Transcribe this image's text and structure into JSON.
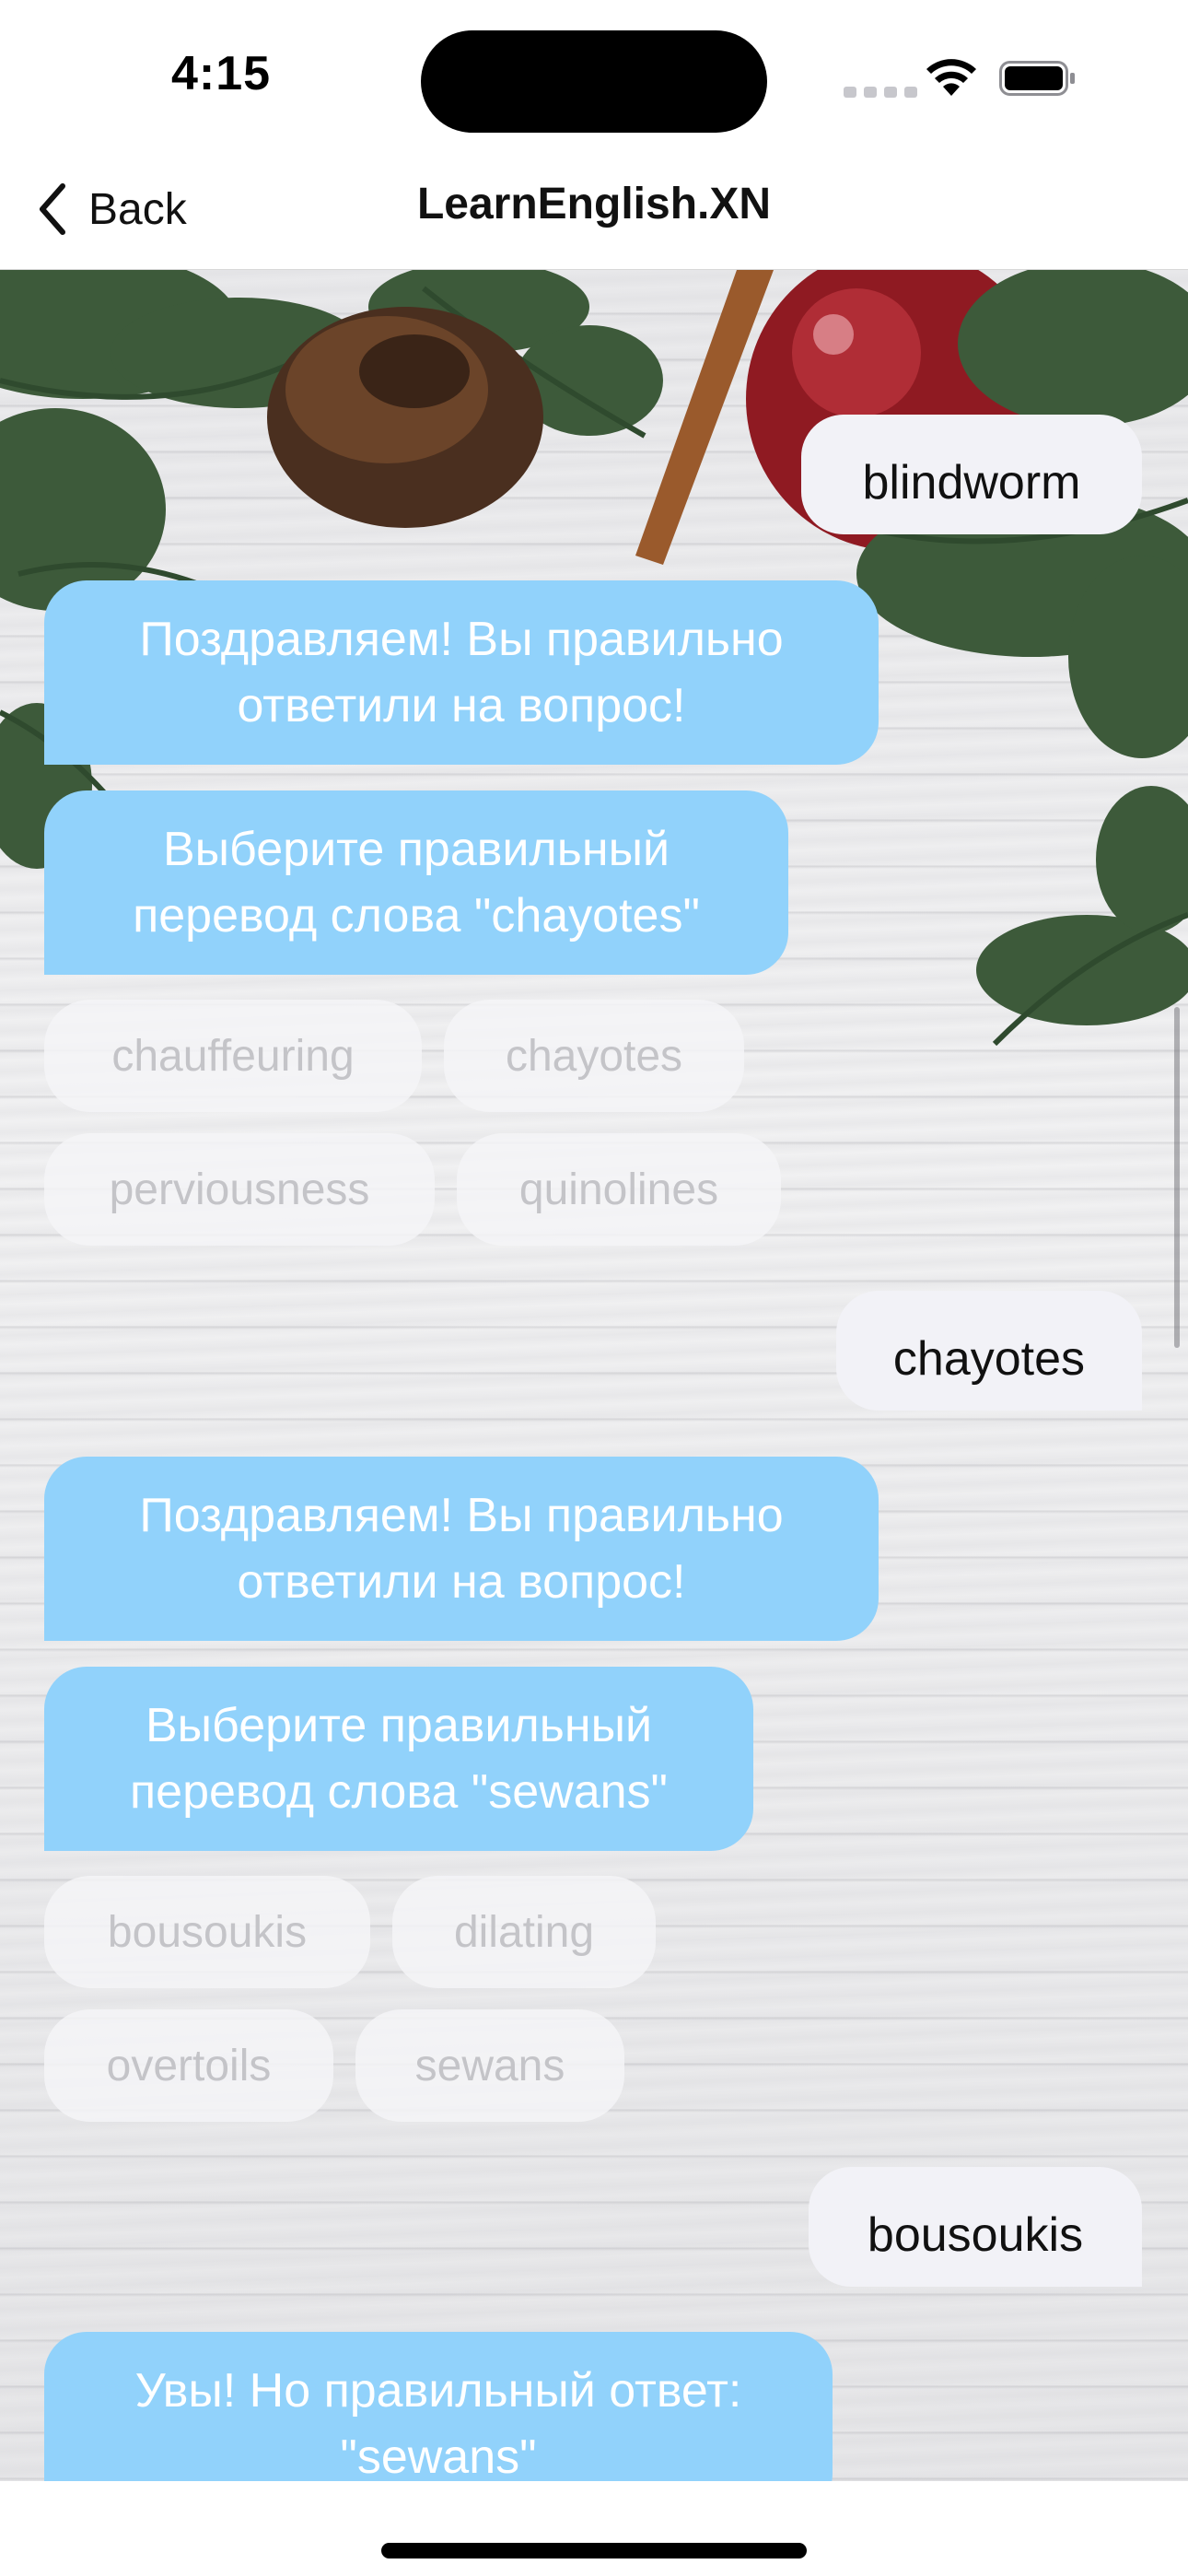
{
  "status_bar": {
    "time": "4:15"
  },
  "nav": {
    "back_label": "Back",
    "title": "LearnEnglish.XN"
  },
  "messages": {
    "user_1": "blindworm",
    "bot_1": "Поздравляем! Вы правильно ответили на вопрос!",
    "bot_2": "Выберите правильный перевод слова \"chayotes\"",
    "choices_1": [
      "chauffeuring",
      "chayotes",
      "perviousness",
      "quinolines"
    ],
    "user_2": "chayotes",
    "bot_3": "Поздравляем! Вы правильно ответили на вопрос!",
    "bot_4": "Выберите правильный перевод слова \"sewans\"",
    "choices_2": [
      "bousoukis",
      "dilating",
      "overtoils",
      "sewans"
    ],
    "user_3": "bousoukis",
    "bot_5": "Увы! Но правильный ответ: \"sewans\""
  },
  "colors": {
    "bot_bubble": "#91d2fb",
    "user_bubble": "#f2f2f7",
    "choice_text": "#c4c4c8"
  },
  "icons": {
    "back": "chevron-left-icon",
    "wifi": "wifi-icon",
    "battery": "battery-icon",
    "signal": "signal-icon"
  }
}
